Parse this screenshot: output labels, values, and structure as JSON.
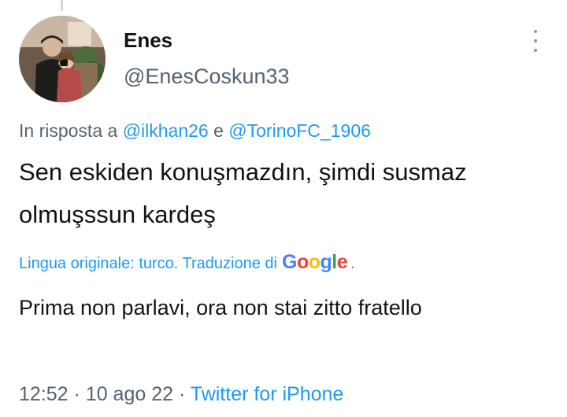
{
  "author": {
    "display_name": "Enes",
    "handle": "@EnesCoskun33",
    "avatar_icon": "profile-photo"
  },
  "reply": {
    "prefix": "In risposta a",
    "mention_1": "@ilkhan26",
    "conjunction": "e",
    "mention_2": "@TorinoFC_1906"
  },
  "tweet": {
    "text": "Sen eskiden konuşmazdın, şimdi susmaz olmuşssun kardeş"
  },
  "translation": {
    "label": "Lingua originale: turco. Traduzione di",
    "provider": "Google",
    "suffix": ".",
    "text": "Prima non parlavi, ora non stai zitto fratello"
  },
  "meta": {
    "time": "12:52",
    "separator": "·",
    "date": "10 ago 22",
    "source": "Twitter for iPhone"
  },
  "colors": {
    "accent": "#1d9bf0",
    "secondary_text": "#536471",
    "primary_text": "#0f1419"
  }
}
